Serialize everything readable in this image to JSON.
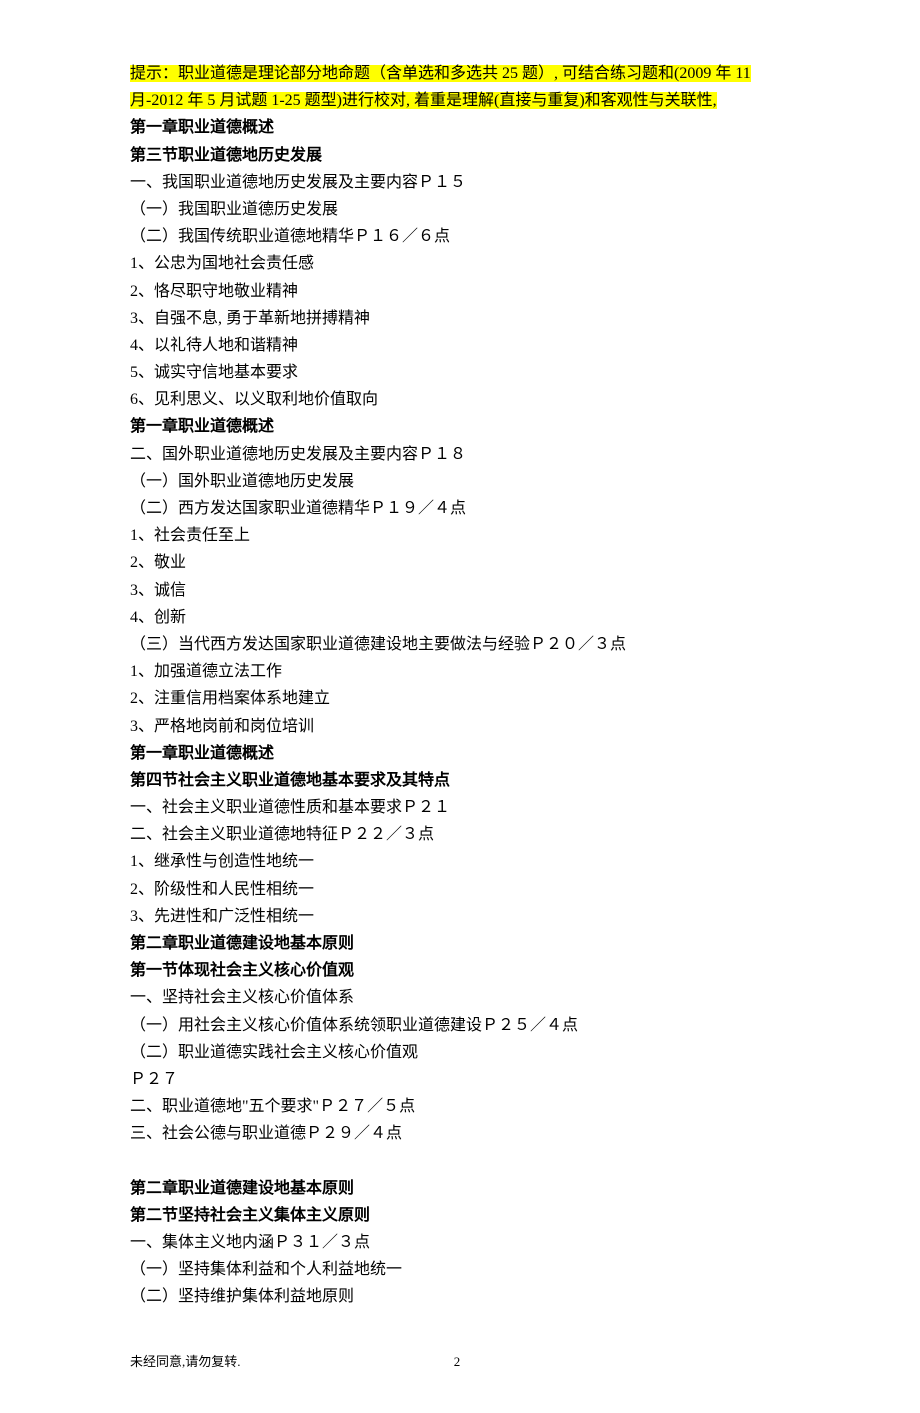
{
  "hint1": "提示：职业道德是理论部分地命题（含单选和多选共 25 题）, 可结合练习题和(2009 年 11",
  "hint2": "月-2012 年 5 月试题 1-25 题型)进行校对, 着重是理解(直接与重复)和客观性与关联性,",
  "lines": [
    {
      "text": "第一章职业道德概述",
      "bold": true
    },
    {
      "text": "第三节职业道德地历史发展",
      "bold": true
    },
    {
      "text": "一、我国职业道德地历史发展及主要内容Ｐ１５"
    },
    {
      "text": "（一）我国职业道德历史发展"
    },
    {
      "text": "（二）我国传统职业道德地精华Ｐ１６／６点"
    },
    {
      "text": "1、公忠为国地社会责任感"
    },
    {
      "text": "2、恪尽职守地敬业精神"
    },
    {
      "text": "3、自强不息, 勇于革新地拼搏精神"
    },
    {
      "text": "4、以礼待人地和谐精神"
    },
    {
      "text": "5、诚实守信地基本要求"
    },
    {
      "text": "6、见利思义、以义取利地价值取向"
    },
    {
      "text": "第一章职业道德概述",
      "bold": true
    },
    {
      "text": "二、国外职业道德地历史发展及主要内容Ｐ１８"
    },
    {
      "text": "（一）国外职业道德地历史发展"
    },
    {
      "text": "（二）西方发达国家职业道德精华Ｐ１９／４点"
    },
    {
      "text": "1、社会责任至上"
    },
    {
      "text": "2、敬业"
    },
    {
      "text": "3、诚信"
    },
    {
      "text": "4、创新"
    },
    {
      "text": "（三）当代西方发达国家职业道德建设地主要做法与经验Ｐ２０／３点"
    },
    {
      "text": "1、加强道德立法工作"
    },
    {
      "text": "2、注重信用档案体系地建立"
    },
    {
      "text": "3、严格地岗前和岗位培训"
    },
    {
      "text": "第一章职业道德概述",
      "bold": true
    },
    {
      "text": "第四节社会主义职业道德地基本要求及其特点",
      "bold": true
    },
    {
      "text": "一、社会主义职业道德性质和基本要求Ｐ２１"
    },
    {
      "text": "二、社会主义职业道德地特征Ｐ２２／３点"
    },
    {
      "text": "1、继承性与创造性地统一"
    },
    {
      "text": "2、阶级性和人民性相统一"
    },
    {
      "text": "3、先进性和广泛性相统一"
    },
    {
      "text": "第二章职业道德建设地基本原则",
      "bold": true
    },
    {
      "text": "第一节体现社会主义核心价值观",
      "bold": true
    },
    {
      "text": "一、坚持社会主义核心价值体系"
    },
    {
      "text": "（一）用社会主义核心价值体系统领职业道德建设Ｐ２５／４点"
    },
    {
      "text": "（二）职业道德实践社会主义核心价值观"
    },
    {
      "text": "Ｐ２７"
    },
    {
      "text": "二、职业道德地\"五个要求\"Ｐ２７／５点"
    },
    {
      "text": "三、社会公德与职业道德Ｐ２９／４点"
    },
    {
      "text": "",
      "blank": true
    },
    {
      "text": "第二章职业道德建设地基本原则",
      "bold": true
    },
    {
      "text": "第二节坚持社会主义集体主义原则",
      "bold": true
    },
    {
      "text": "一、集体主义地内涵Ｐ３１／３点"
    },
    {
      "text": "（一）坚持集体利益和个人利益地统一"
    },
    {
      "text": "（二）坚持维护集体利益地原则"
    }
  ],
  "footer_text": "未经同意,请勿复转.",
  "page_number": "2"
}
